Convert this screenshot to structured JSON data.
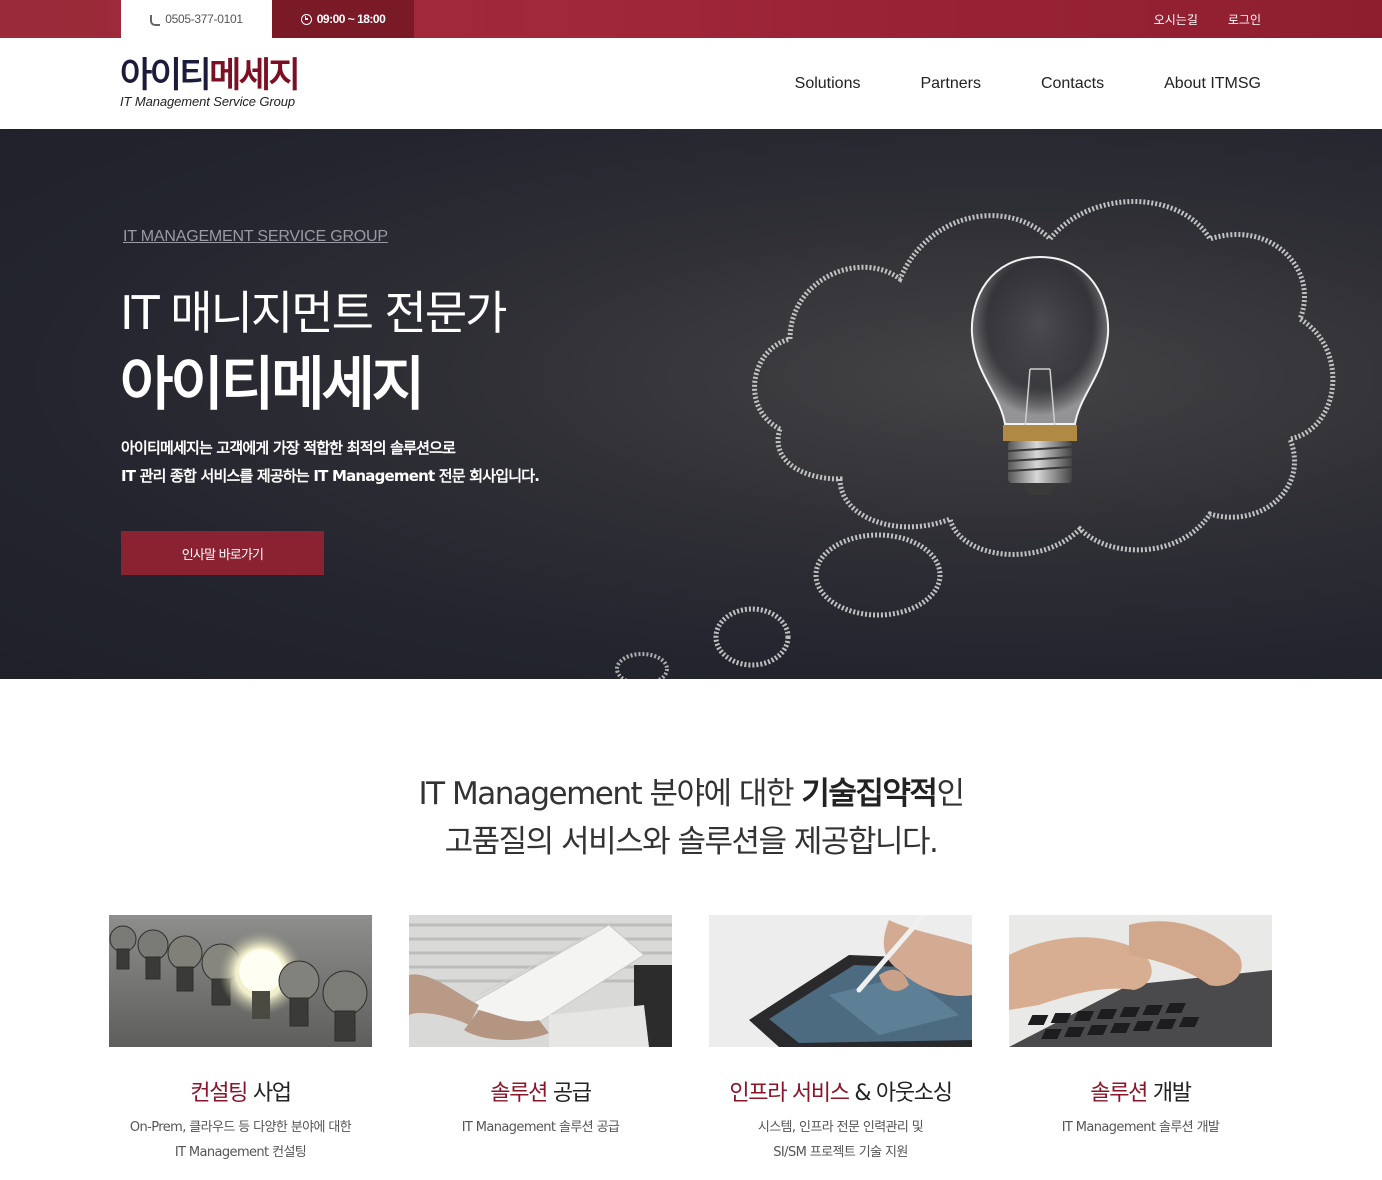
{
  "topbar": {
    "phone": "0505-377-0101",
    "hours": "09:00 ~ 18:00",
    "links": [
      "오시는길",
      "로그인"
    ]
  },
  "header": {
    "logo_part1": "아이티",
    "logo_part2": "메세지",
    "logo_sub": "IT Management Service Group",
    "nav": [
      "Solutions",
      "Partners",
      "Contacts",
      "About ITMSG"
    ]
  },
  "hero": {
    "eyebrow": "IT MANAGEMENT SERVICE GROUP",
    "title_line1": "IT 매니지먼트 전문가",
    "title_line2": "아이티메세지",
    "desc_line1": "아이티메세지는 고객에게 가장 적합한 최적의 솔루션으로",
    "desc_line2": "IT 관리 종합 서비스를 제공하는 IT Management 전문 회사입니다.",
    "cta": "인사말 바로가기"
  },
  "intro": {
    "line1_pre": "IT Management 분야에 대한 ",
    "line1_bold": "기술집약적",
    "line1_post": "인",
    "line2": "고품질의 서비스와 솔루션을 제공합니다."
  },
  "services": [
    {
      "title_hl": "컨설팅",
      "title_rest": " 사업",
      "text1": "On-Prem, 클라우드 등 다양한 분야에 대한",
      "text2": "IT Management 컨설팅",
      "image_icon": "light-bulbs-photo"
    },
    {
      "title_hl": "솔루션",
      "title_rest": " 공급",
      "text1": "IT Management 솔루션 공급",
      "text2": "",
      "image_icon": "documents-handover-photo"
    },
    {
      "title_hl": "인프라 서비스",
      "title_rest": " & 아웃소싱",
      "text1": "시스템, 인프라 전문 인력관리 및",
      "text2": "SI/SM 프로젝트 기술 지원",
      "image_icon": "tablet-stylus-photo"
    },
    {
      "title_hl": "솔루션",
      "title_rest": " 개발",
      "text1": "IT Management 솔루션 개발",
      "text2": "",
      "image_icon": "keyboard-typing-photo"
    }
  ],
  "colors": {
    "brand": "#8a2231",
    "brand_dark": "#7a1a27",
    "accent_text": "#8a1428",
    "hero_bg": "#23242e"
  }
}
